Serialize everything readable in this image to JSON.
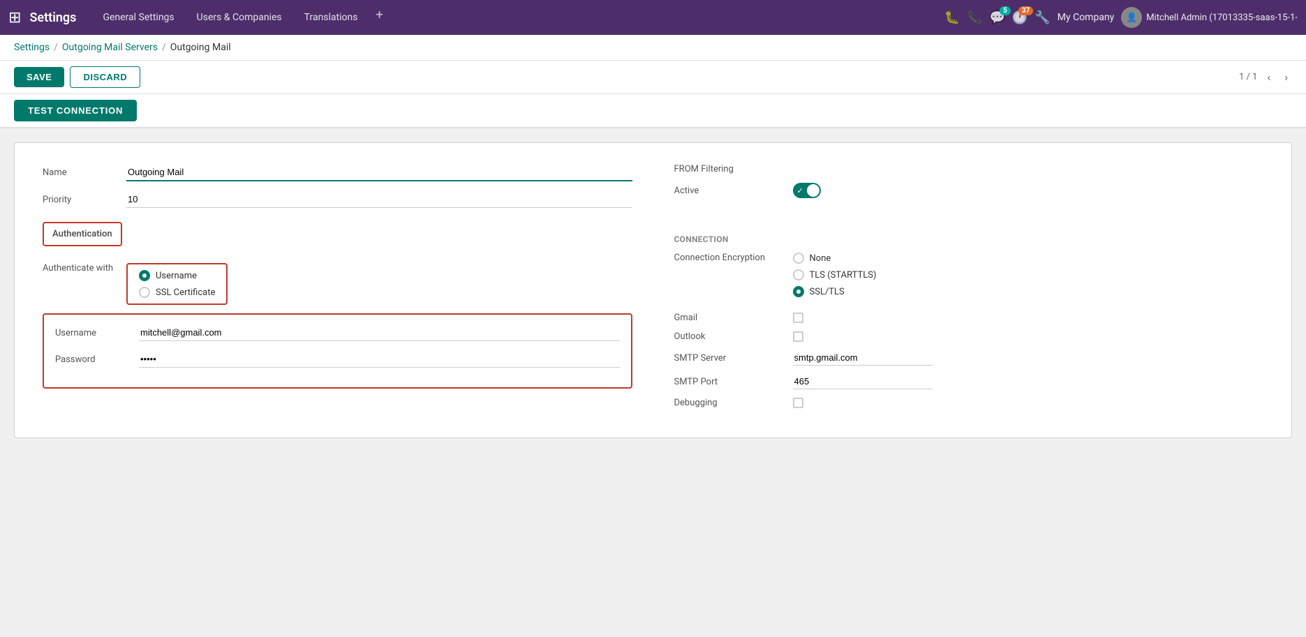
{
  "topbar": {
    "app_grid_icon": "⊞",
    "title": "Settings",
    "nav_items": [
      {
        "label": "General Settings",
        "key": "general-settings"
      },
      {
        "label": "Users & Companies",
        "key": "users-companies"
      },
      {
        "label": "Translations",
        "key": "translations"
      }
    ],
    "plus_label": "+",
    "actions": {
      "bug_icon": "🐛",
      "phone_icon": "📞",
      "chat_icon": "💬",
      "chat_badge": "5",
      "clock_icon": "🕐",
      "clock_badge": "37",
      "wrench_icon": "🔧",
      "company_label": "My Company",
      "user_label": "Mitchell Admin (17013335-saas-15-1-"
    }
  },
  "breadcrumb": {
    "part1": "Settings",
    "sep1": "/",
    "part2": "Outgoing Mail Servers",
    "sep2": "/",
    "part3": "Outgoing Mail"
  },
  "actionbar": {
    "save_label": "SAVE",
    "discard_label": "DISCARD",
    "pagination_current": "1 / 1"
  },
  "testbar": {
    "test_connection_label": "TEST CONNECTION"
  },
  "form": {
    "left": {
      "name_label": "Name",
      "name_value": "Outgoing Mail",
      "priority_label": "Priority",
      "priority_value": "10",
      "authentication_section": "Authentication",
      "authenticate_with_label": "Authenticate with",
      "auth_options": [
        {
          "label": "Username",
          "checked": true
        },
        {
          "label": "SSL Certificate",
          "checked": false
        }
      ],
      "username_label": "Username",
      "username_value": "mitchell@gmail.com",
      "password_label": "Password",
      "password_value": "•••••"
    },
    "right": {
      "from_filtering_label": "FROM Filtering",
      "active_label": "Active",
      "connection_section_label": "Connection",
      "connection_encryption_label": "Connection Encryption",
      "encryption_options": [
        {
          "label": "None",
          "checked": false
        },
        {
          "label": "TLS (STARTTLS)",
          "checked": false
        },
        {
          "label": "SSL/TLS",
          "checked": true
        }
      ],
      "gmail_label": "Gmail",
      "outlook_label": "Outlook",
      "smtp_server_label": "SMTP Server",
      "smtp_server_value": "smtp.gmail.com",
      "smtp_port_label": "SMTP Port",
      "smtp_port_value": "465",
      "debugging_label": "Debugging"
    }
  }
}
